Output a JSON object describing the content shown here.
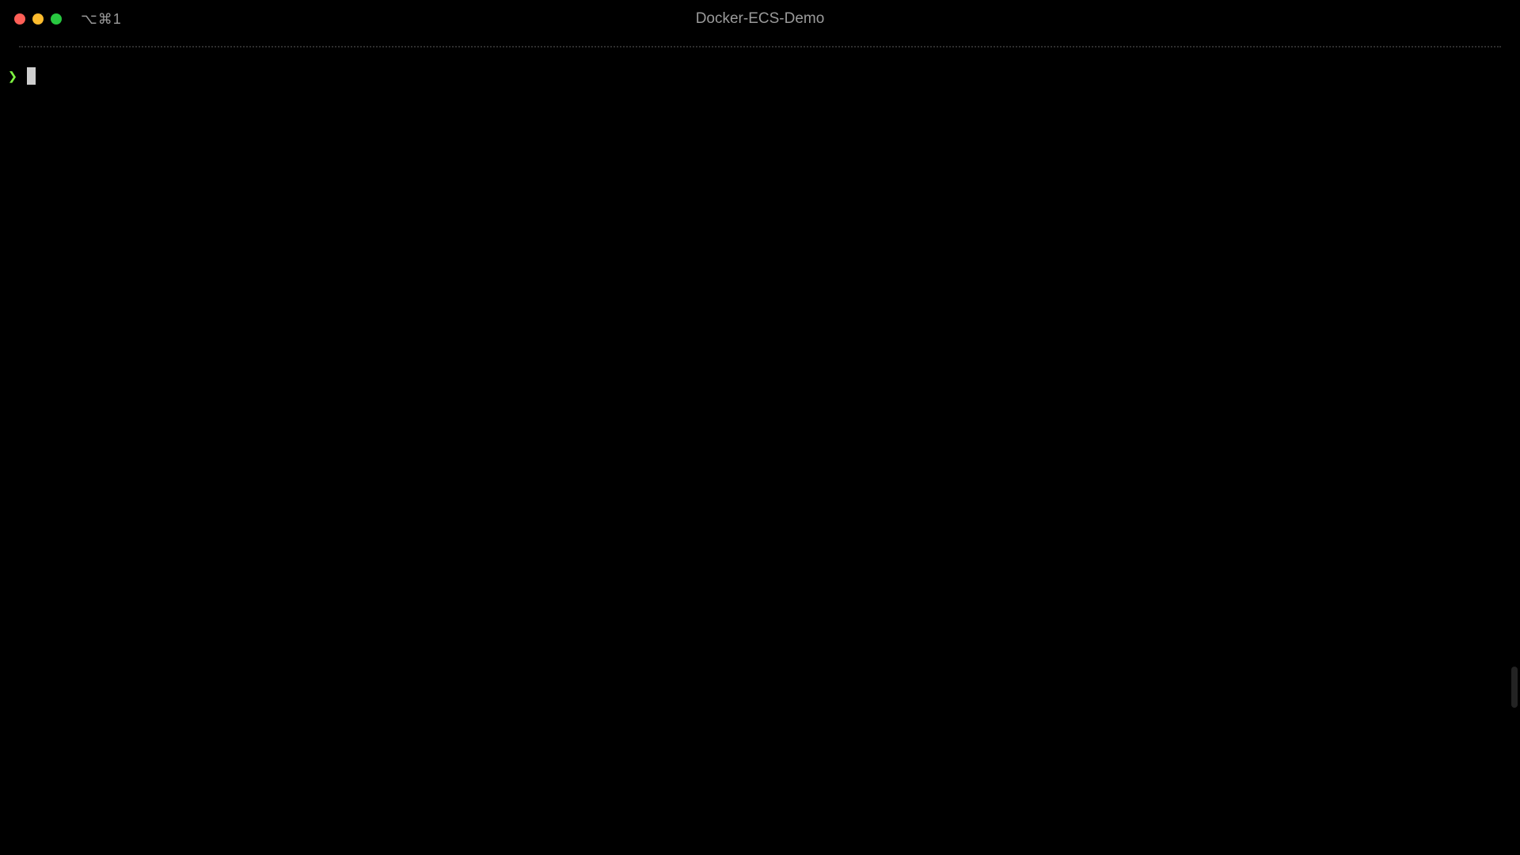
{
  "window": {
    "title": "Docker-ECS-Demo",
    "pane_badge": "⌥⌘1"
  },
  "terminal": {
    "prompt_symbol": "❯",
    "input_value": ""
  }
}
